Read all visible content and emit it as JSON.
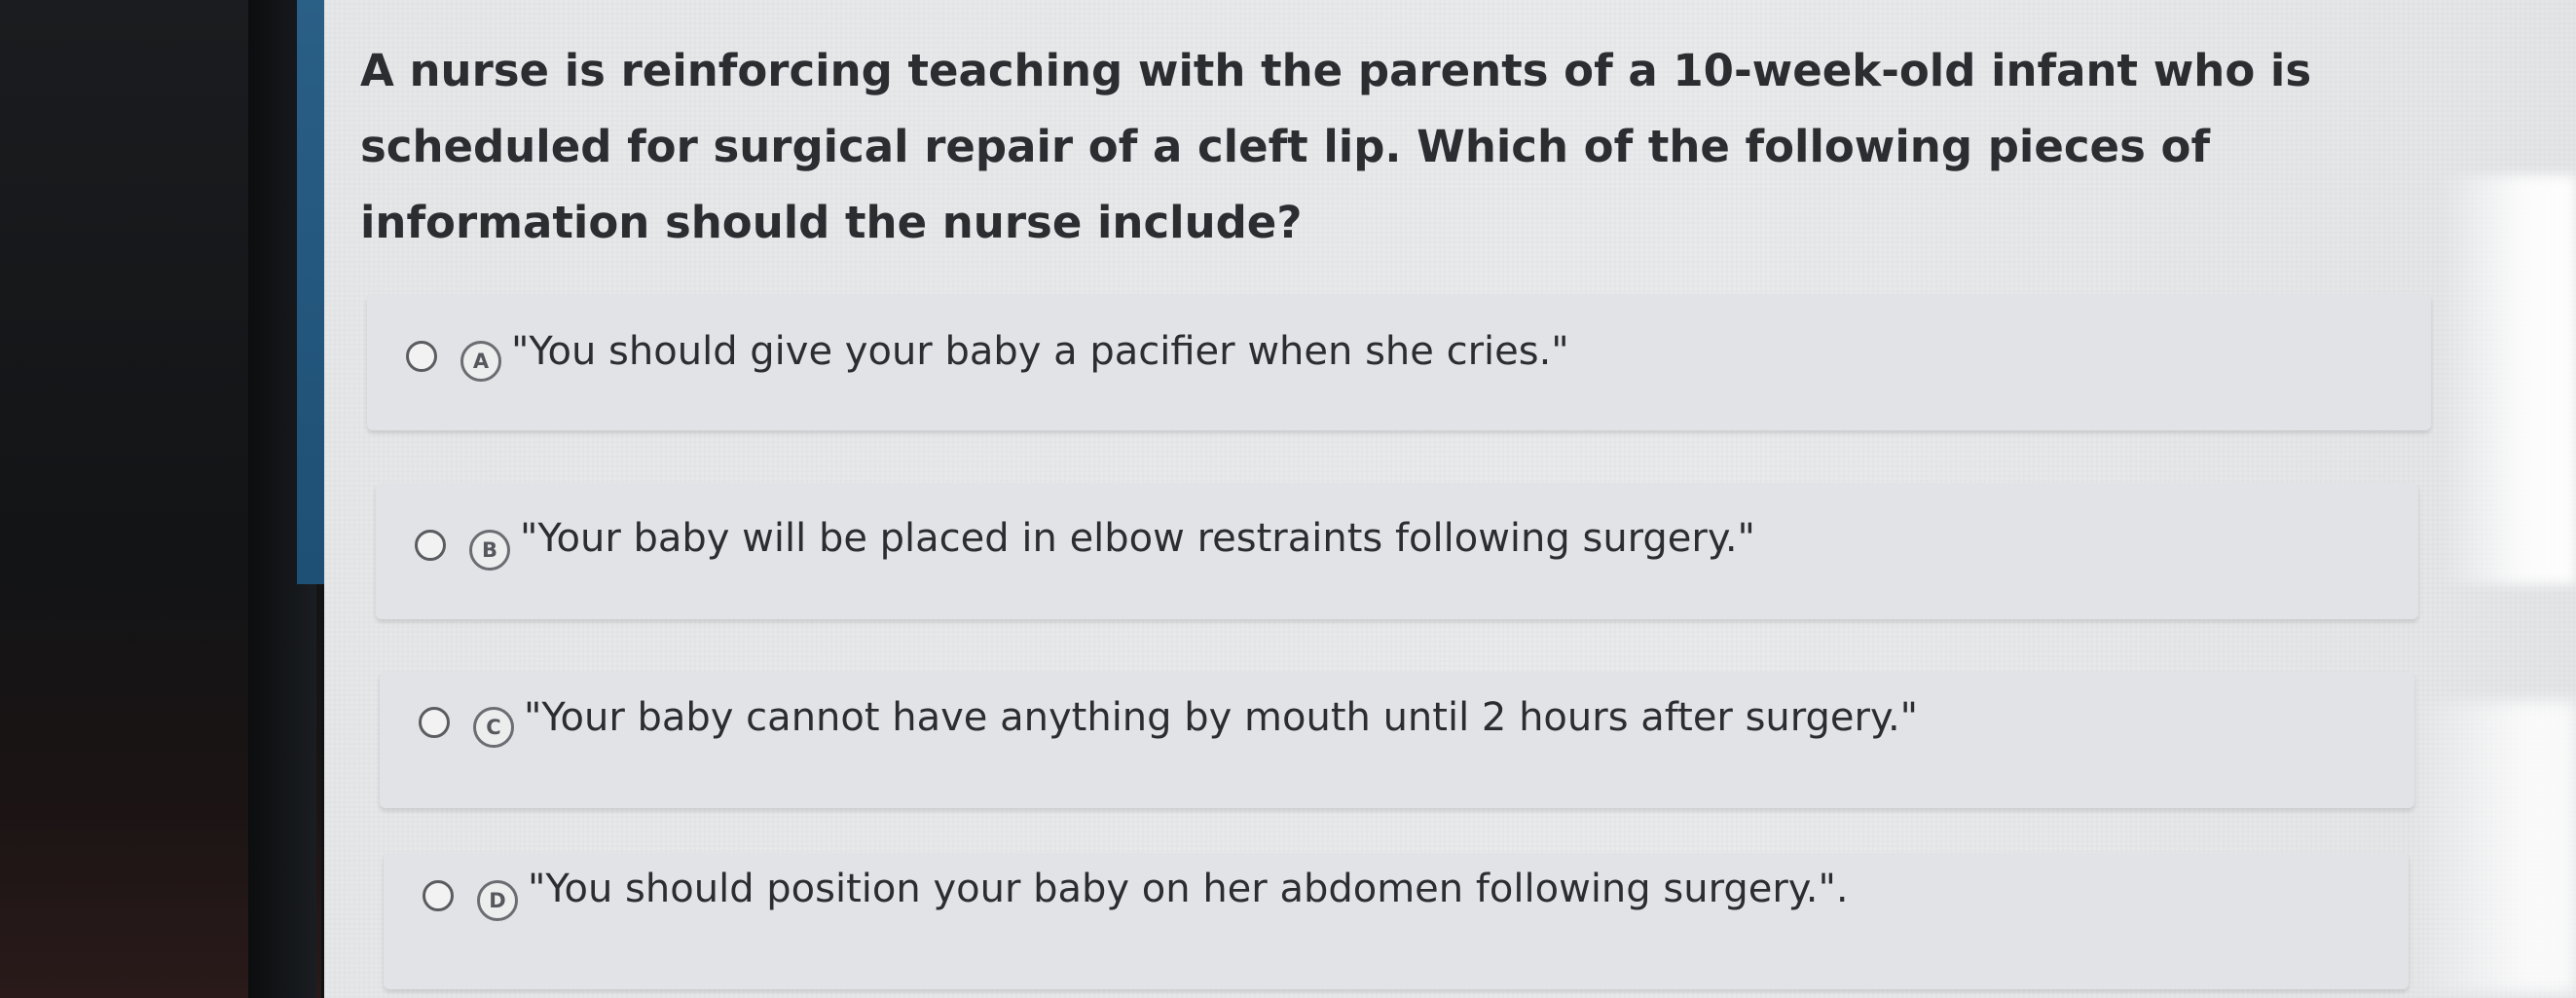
{
  "question": {
    "text": "A nurse is reinforcing teaching with the parents of a 10-week-old infant who is scheduled for surgical repair of a cleft lip. Which of the following pieces of information should the nurse include?"
  },
  "options": [
    {
      "letter": "A",
      "text": "\"You should give your baby a pacifier when she cries.\"",
      "selected": false
    },
    {
      "letter": "B",
      "text": "\"Your baby will be placed in elbow restraints following surgery.\"",
      "selected": false
    },
    {
      "letter": "C",
      "text": "\"Your baby cannot have anything by mouth until 2 hours after surgery.\"",
      "selected": false
    },
    {
      "letter": "D",
      "text": "\"You should position your baby on her abdomen following surgery.\".",
      "selected": false
    }
  ],
  "colors": {
    "text": "#2b2d31",
    "card": "#e2e3e6",
    "accent": "#1e4f74"
  }
}
